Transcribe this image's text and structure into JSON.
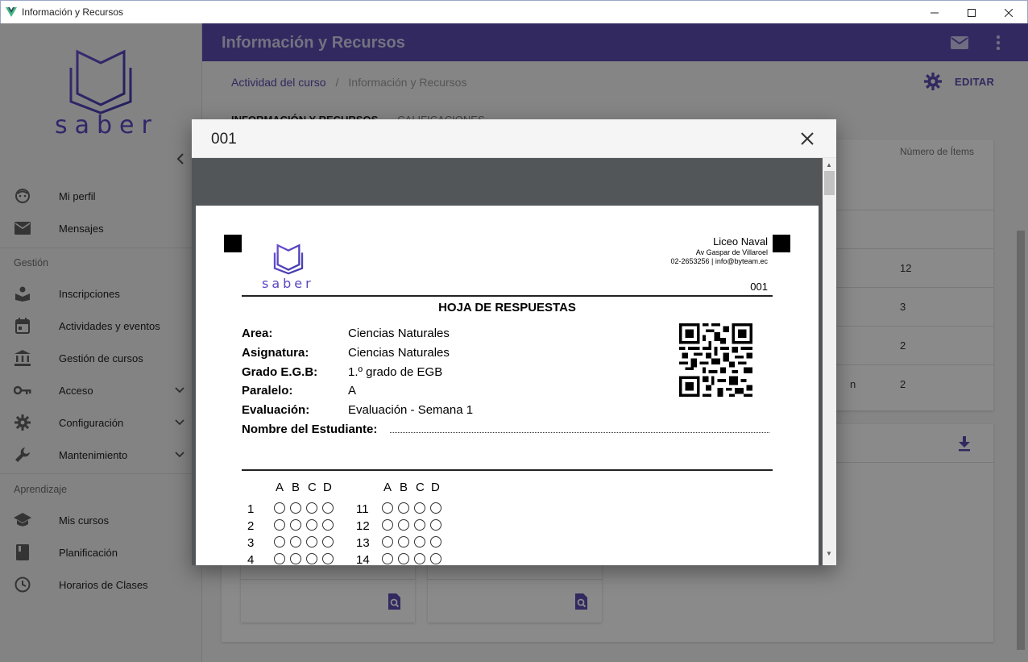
{
  "window": {
    "title": "Información y Recursos",
    "logo_icon": "vue-logo-icon",
    "controls": [
      "minimize-icon",
      "maximize-icon",
      "close-icon"
    ]
  },
  "sidebar": {
    "brand_text": "saber",
    "items_main": [
      {
        "label": "Mi perfil",
        "icon": "face-icon"
      },
      {
        "label": "Mensajes",
        "icon": "mail-icon"
      }
    ],
    "section_gestion": "Gestión",
    "items_gestion": [
      {
        "label": "Inscripciones",
        "icon": "enroll-icon"
      },
      {
        "label": "Actividades y eventos",
        "icon": "calendar-icon"
      },
      {
        "label": "Gestión de cursos",
        "icon": "bank-icon"
      },
      {
        "label": "Acceso",
        "icon": "key-icon",
        "expandable": true
      },
      {
        "label": "Configuración",
        "icon": "gear-icon",
        "expandable": true
      },
      {
        "label": "Mantenimiento",
        "icon": "wrench-icon",
        "expandable": true
      }
    ],
    "section_aprendizaje": "Aprendizaje",
    "items_aprendizaje": [
      {
        "label": "Mis cursos",
        "icon": "school-icon"
      },
      {
        "label": "Planificación",
        "icon": "book-icon"
      },
      {
        "label": "Horarios de Clases",
        "icon": "clock-icon"
      }
    ]
  },
  "appbar": {
    "title": "Información y Recursos"
  },
  "breadcrumb": {
    "link": "Actividad del curso",
    "separator": "/",
    "current": "Información y Recursos"
  },
  "edit_label": "EDITAR",
  "tabs": [
    {
      "label": "INFORMACIÓN Y RECURSOS",
      "active": true
    },
    {
      "label": "CALIFICACIONES",
      "active": false
    }
  ],
  "table": {
    "column_header": "Número de Ítems",
    "rows": [
      {
        "count": ""
      },
      {
        "count": ""
      },
      {
        "count": "12"
      },
      {
        "count": "3"
      },
      {
        "count": "2"
      },
      {
        "count": "2",
        "fragment": "n"
      }
    ]
  },
  "dialog": {
    "title": "001",
    "sheet": {
      "school_name": "Liceo Naval",
      "address": "Av Gaspar de Villaroel",
      "contact": "02-2653256 | info@byteam.ec",
      "sheet_number": "001",
      "brand_text": "saber",
      "title": "HOJA DE RESPUESTAS",
      "fields": [
        {
          "label": "Area:",
          "value": "Ciencias Naturales"
        },
        {
          "label": "Asignatura:",
          "value": "Ciencias Naturales"
        },
        {
          "label": "Grado E.G.B:",
          "value": "1.º grado de EGB"
        },
        {
          "label": "Paralelo:",
          "value": "A"
        },
        {
          "label": "Evaluación:",
          "value": "Evaluación - Semana 1"
        }
      ],
      "student_label": "Nombre del Estudiante:",
      "options": [
        "A",
        "B",
        "C",
        "D"
      ],
      "questions_col1": [
        "1",
        "2",
        "3",
        "4"
      ],
      "questions_col2": [
        "11",
        "12",
        "13",
        "14"
      ]
    }
  },
  "colors": {
    "primary": "#5c4db1",
    "sidebar_bg": "#f2f2f2",
    "viewer_bg": "#525659"
  }
}
